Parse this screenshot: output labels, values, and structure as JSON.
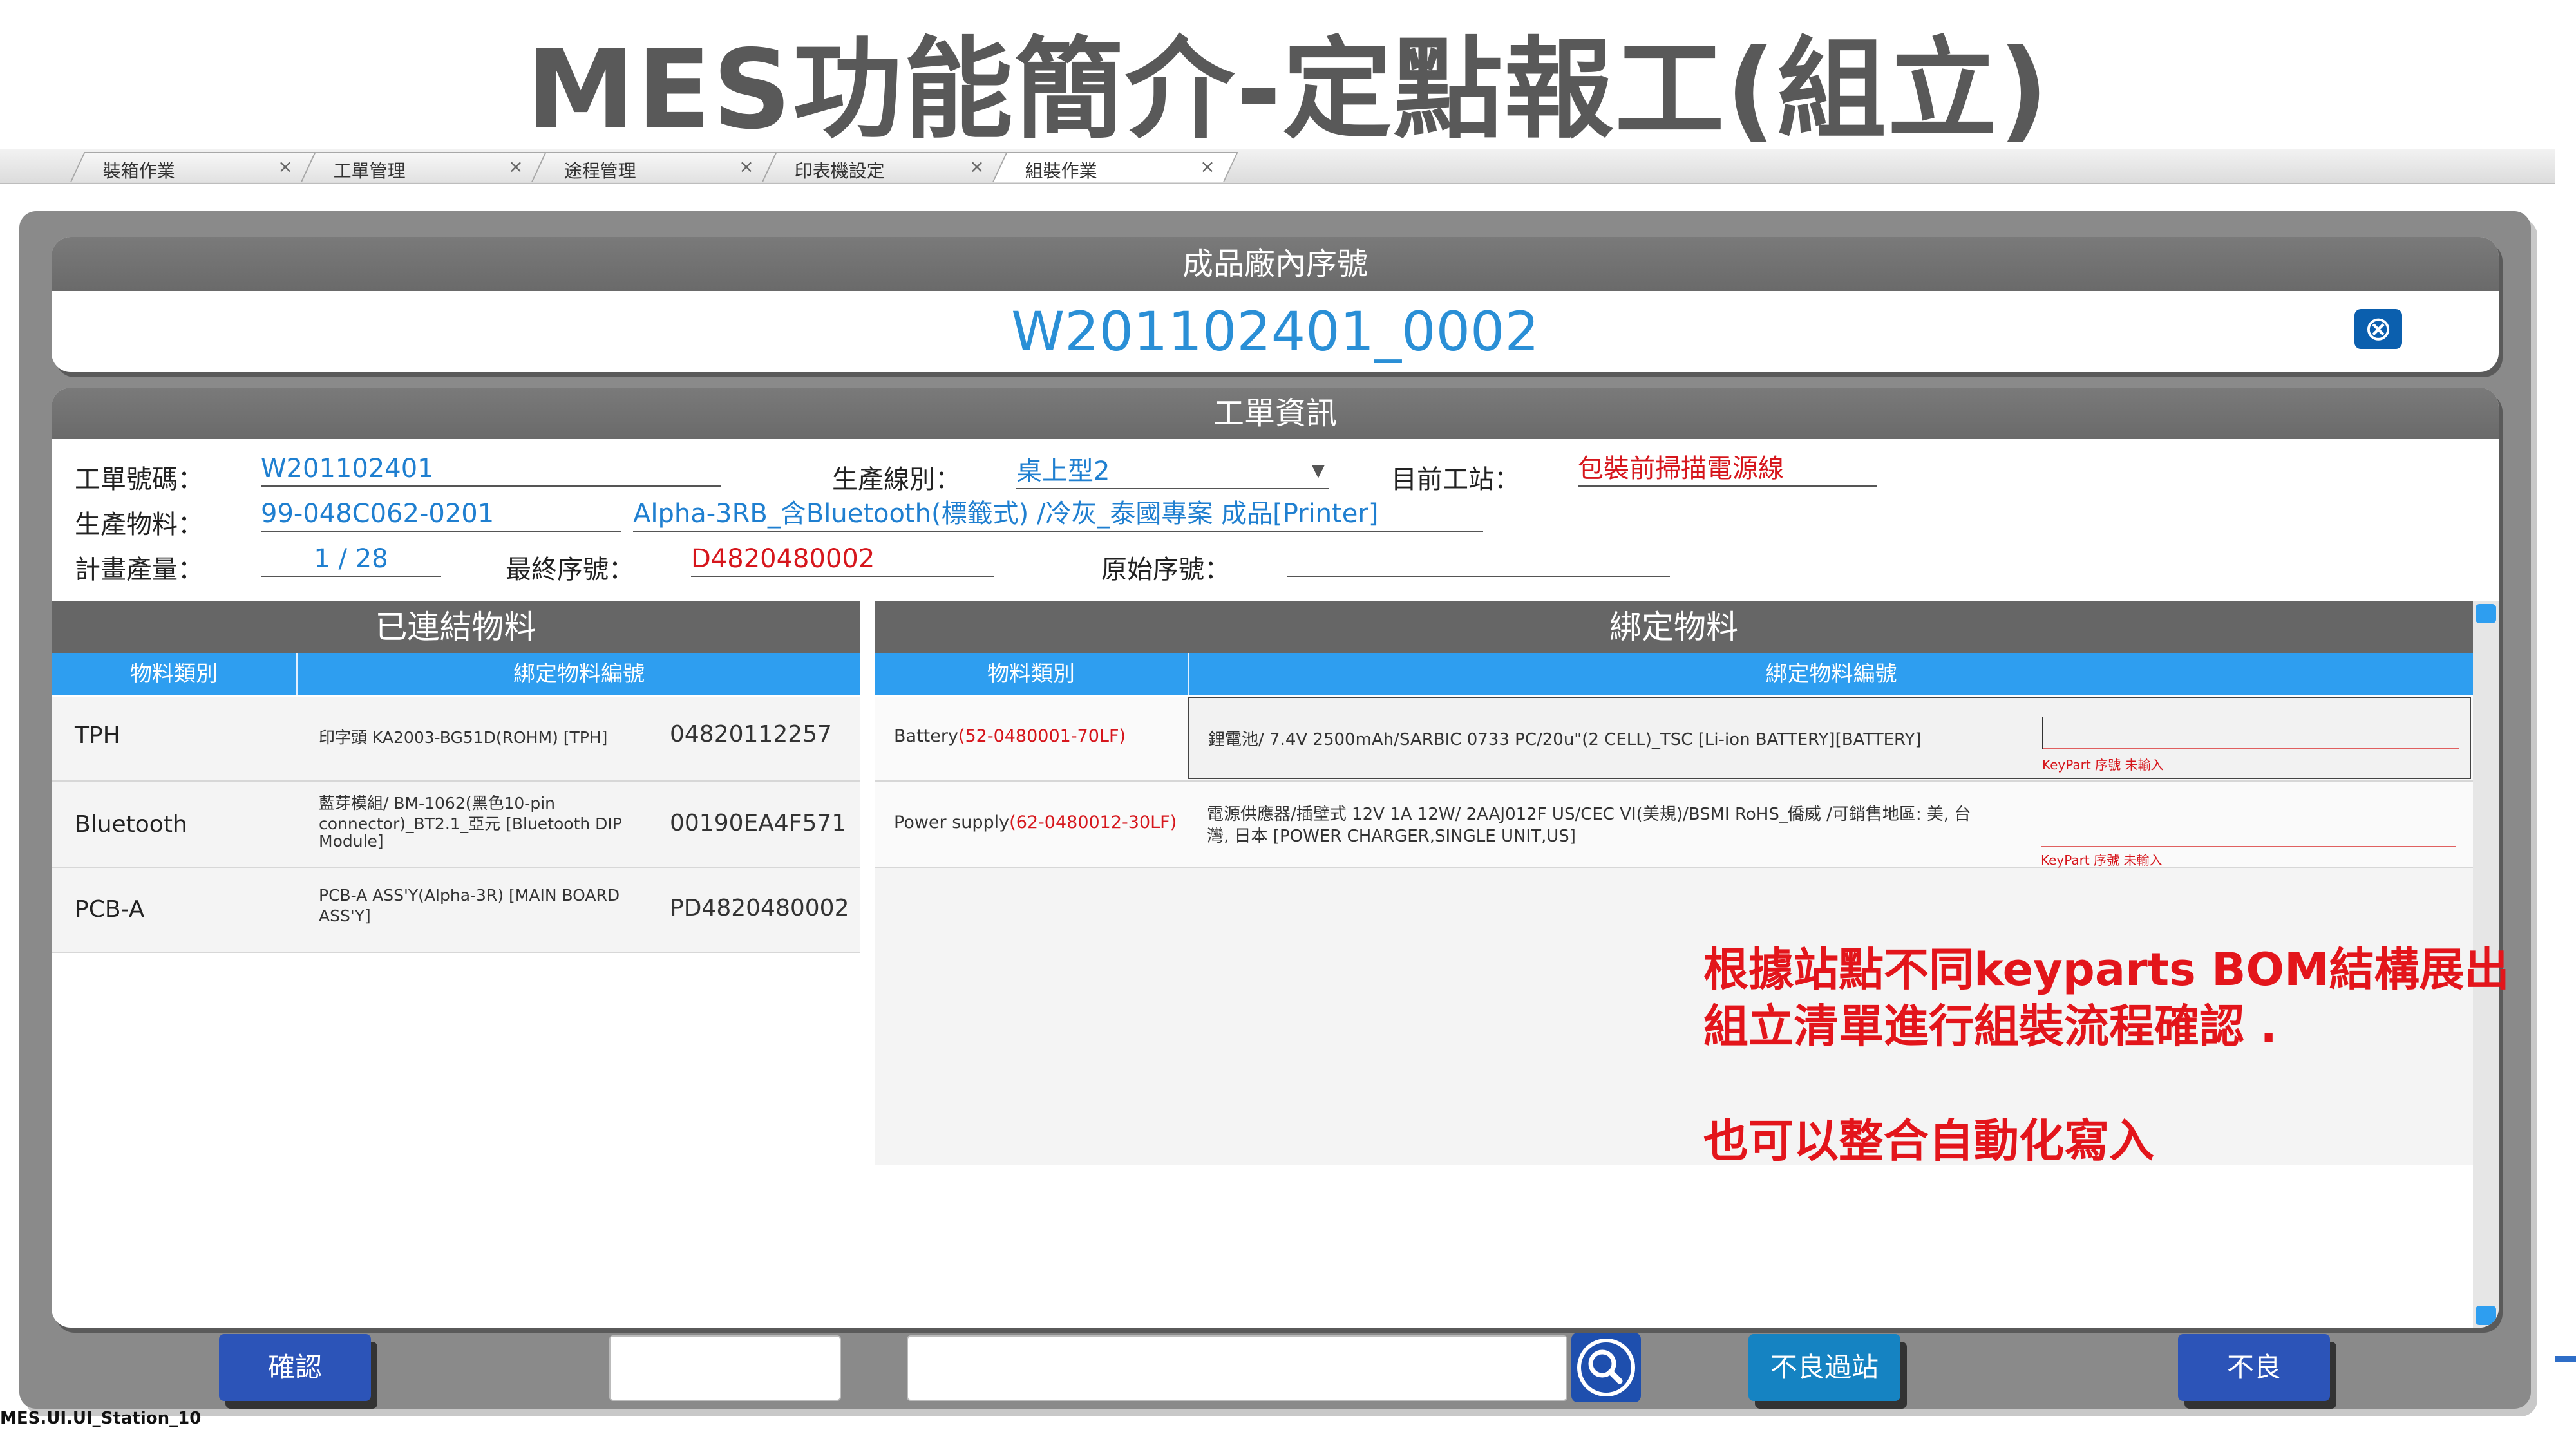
{
  "slide": {
    "title": "MES功能簡介-定點報工(組立)"
  },
  "tabs": [
    {
      "label": "裝箱作業",
      "close": "×"
    },
    {
      "label": "工單管理",
      "close": "×"
    },
    {
      "label": "途程管理",
      "close": "×"
    },
    {
      "label": "印表機設定",
      "close": "×"
    },
    {
      "label": "組裝作業",
      "close": "×",
      "active": true
    }
  ],
  "serial": {
    "header": "成品廠內序號",
    "value": "W201102401_0002",
    "clear_icon": "⊗"
  },
  "work_order": {
    "header": "工單資訊",
    "wo_no_label": "工單號碼：",
    "wo_no": "W201102401",
    "line_label": "生產線別：",
    "line": "桌上型2",
    "line_caret": "▾",
    "station_label": "目前工站：",
    "station": "包裝前掃描電源線",
    "material_label": "生產物料：",
    "material_code": "99-048C062-0201",
    "material_desc": "Alpha-3RB_含Bluetooth(標籤式) /冷灰_泰國專案 成品[Printer]",
    "qty_label": "計畫產量：",
    "qty": "1 / 28",
    "final_sn_label": "最終序號：",
    "final_sn": "D4820480002",
    "orig_sn_label": "原始序號：",
    "orig_sn": ""
  },
  "linked": {
    "title": "已連結物料",
    "col1": "物料類別",
    "col2": "綁定物料編號",
    "rows": [
      {
        "type": "TPH",
        "desc": [
          "印字頭 KA2003-BG51D(ROHM) [TPH]"
        ],
        "sn": "04820112257"
      },
      {
        "type": "Bluetooth",
        "desc": [
          "藍芽模組/ BM-1062(黑色10-pin",
          "connector)_BT2.1_亞元 [Bluetooth DIP",
          "Module]"
        ],
        "sn": "00190EA4F571"
      },
      {
        "type": "PCB-A",
        "desc": [
          "PCB-A ASS'Y(Alpha-3R) [MAIN BOARD",
          "ASS'Y]"
        ],
        "sn": "PD4820480002"
      }
    ]
  },
  "binding": {
    "title": "綁定物料",
    "col1": "物料類別",
    "col2": "綁定物料編號",
    "rows": [
      {
        "type": "Battery",
        "code": "(52-0480001-70LF)",
        "desc": [
          "鋰電池/ 7.4V 2500mAh/SARBIC 0733 PC/20u\"(2 CELL)_TSC [Li-ion BATTERY][BATTERY]"
        ],
        "hint": "KeyPart 序號 未輸入"
      },
      {
        "type": "Power supply",
        "code": "(62-0480012-30LF)",
        "desc": [
          "電源供應器/插壁式 12V 1A 12W/ 2AAJ012F US/CEC VI(美規)/BSMI RoHS_僑威 /可銷售地區: 美, 台",
          "灣, 日本 [POWER CHARGER,SINGLE UNIT,US]"
        ],
        "hint": "KeyPart 序號 未輸入"
      }
    ]
  },
  "note": {
    "line1": "根據站點不同keyparts BOM結構展出",
    "line2": "組立清單進行組裝流程確認 .",
    "line3": "也可以整合自動化寫入"
  },
  "buttons": {
    "confirm": "確認",
    "bad_pass": "不良過站",
    "bad": "不良"
  },
  "status": {
    "app_id": "MES.UI.UI_Station_10"
  },
  "colors": {
    "accent_blue": "#1f7fd0",
    "header_gray": "#6a6a6a",
    "alert_red": "#d6161c",
    "button_blue": "#2c54b8",
    "button_teal": "#1583c2"
  }
}
